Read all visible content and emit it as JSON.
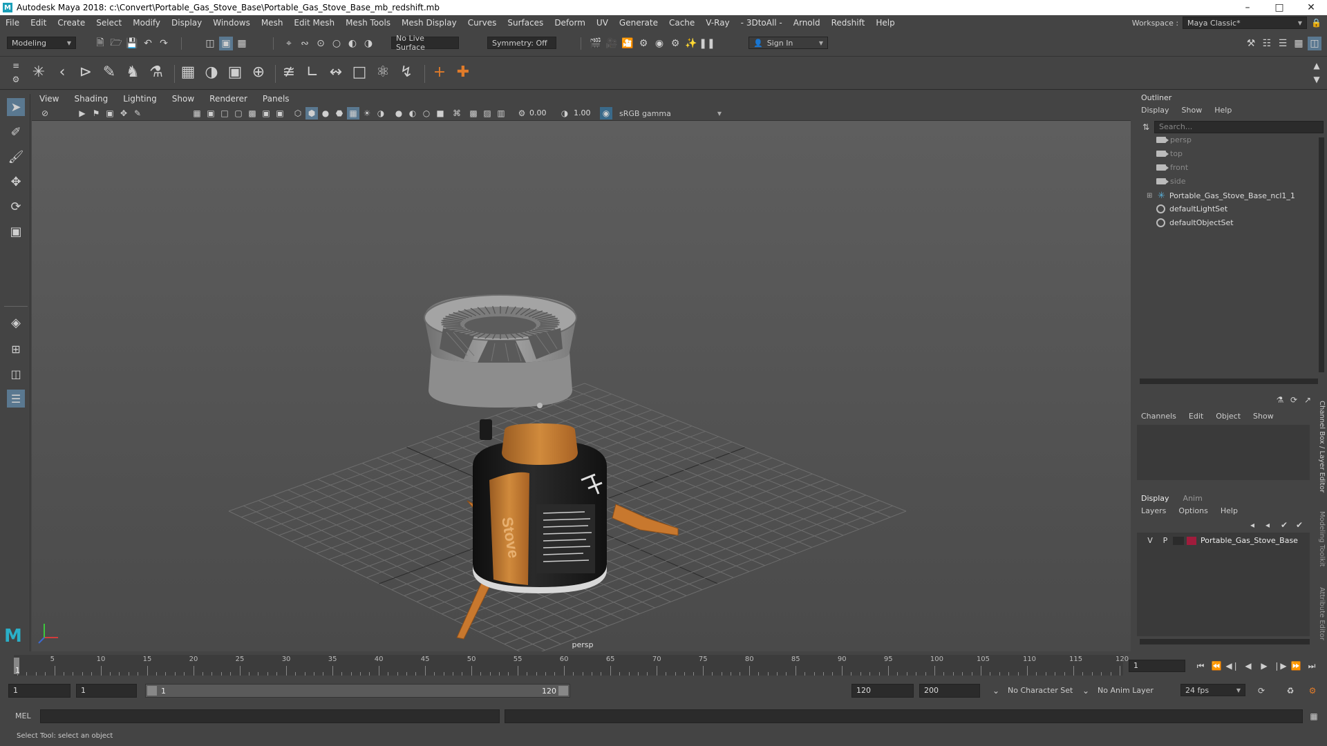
{
  "window": {
    "title": "Autodesk Maya 2018: c:\\Convert\\Portable_Gas_Stove_Base\\Portable_Gas_Stove_Base_mb_redshift.mb",
    "logo_letter": "M"
  },
  "menubar": {
    "items": [
      "File",
      "Edit",
      "Create",
      "Select",
      "Modify",
      "Display",
      "Windows",
      "Mesh",
      "Edit Mesh",
      "Mesh Tools",
      "Mesh Display",
      "Curves",
      "Surfaces",
      "Deform",
      "UV",
      "Generate",
      "Cache",
      "V-Ray",
      "- 3DtoAll -",
      "Arnold",
      "Redshift",
      "Help"
    ],
    "workspace_label": "Workspace :",
    "workspace_value": "Maya Classic*"
  },
  "statusline": {
    "mode": "Modeling",
    "live_surface": "No Live Surface",
    "symmetry": "Symmetry: Off",
    "sign_in": "Sign In"
  },
  "viewport": {
    "menus": [
      "View",
      "Shading",
      "Lighting",
      "Show",
      "Renderer",
      "Panels"
    ],
    "exposure": "0.00",
    "gamma": "1.00",
    "color_space": "sRGB gamma",
    "camera_label": "persp",
    "colors": {
      "grid": "#6d6d6d",
      "orange": "#c8782e",
      "canister": "#1c1c1c",
      "metal": "#9a9a9a"
    },
    "label_lines": [
      "Stove"
    ]
  },
  "outliner": {
    "title": "Outliner",
    "menus": [
      "Display",
      "Show",
      "Help"
    ],
    "search_placeholder": "Search...",
    "items": [
      {
        "label": "persp",
        "icon": "camera-icon",
        "dim": true
      },
      {
        "label": "top",
        "icon": "camera-icon",
        "dim": true
      },
      {
        "label": "front",
        "icon": "camera-icon",
        "dim": true
      },
      {
        "label": "side",
        "icon": "camera-icon",
        "dim": true
      },
      {
        "label": "Portable_Gas_Stove_Base_ncl1_1",
        "icon": "group-icon",
        "dim": false
      },
      {
        "label": "defaultLightSet",
        "icon": "set-icon",
        "dim": false
      },
      {
        "label": "defaultObjectSet",
        "icon": "set-icon",
        "dim": false
      }
    ]
  },
  "channelbox": {
    "menus": [
      "Channels",
      "Edit",
      "Object",
      "Show"
    ],
    "layer_tabs": [
      "Display",
      "Anim"
    ],
    "layer_menus": [
      "Layers",
      "Options",
      "Help"
    ],
    "layer": {
      "v": "V",
      "p": "P",
      "name": "Portable_Gas_Stove_Base",
      "color": "#a01c3c"
    },
    "side_tabs": [
      "Channel Box / Layer Editor",
      "Modeling Toolkit",
      "Attribute Editor"
    ]
  },
  "timeslider": {
    "ticks": [
      "5",
      "10",
      "15",
      "20",
      "25",
      "30",
      "35",
      "40",
      "45",
      "50",
      "55",
      "60",
      "65",
      "70",
      "75",
      "80",
      "85",
      "90",
      "95",
      "100",
      "105",
      "110",
      "115",
      "120"
    ],
    "start_tick": "1",
    "current_frame": "1"
  },
  "range": {
    "start": "1",
    "playback_start": "1",
    "range_handle_start": "1",
    "range_handle_end": "120",
    "playback_end": "120",
    "end": "200",
    "character_set": "No Character Set",
    "anim_layer": "No Anim Layer",
    "fps": "24 fps"
  },
  "cmdline": {
    "label": "MEL"
  },
  "helpline": {
    "text": "Select Tool: select an object"
  }
}
